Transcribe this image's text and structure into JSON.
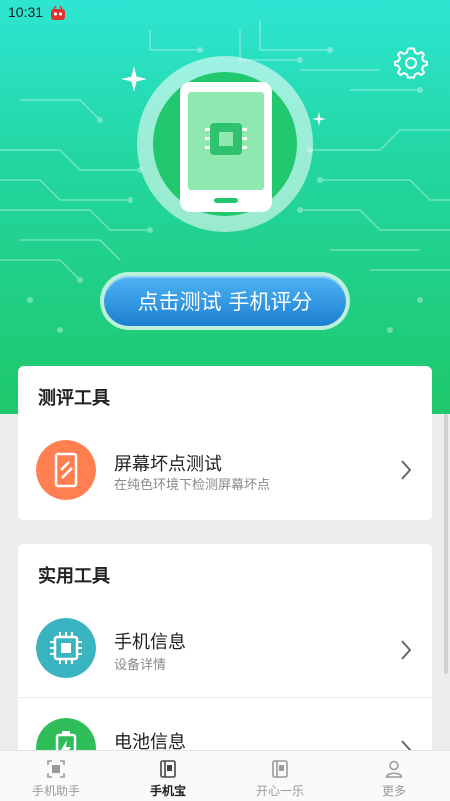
{
  "status_bar": {
    "time": "10:31"
  },
  "hero": {
    "cta_label": "点击测试 手机评分",
    "settings_icon": "gear-icon"
  },
  "evaluation_card": {
    "title": "测评工具",
    "items": [
      {
        "title": "屏幕坏点测试",
        "subtitle": "在纯色环境下检测屏幕坏点",
        "icon": "screen-icon",
        "color": "#ff7f50"
      }
    ]
  },
  "utility_card": {
    "title": "实用工具",
    "items": [
      {
        "title": "手机信息",
        "subtitle": "设备详情",
        "icon": "chip-icon",
        "color": "#3bb4c1"
      },
      {
        "title": "电池信息",
        "subtitle": "",
        "icon": "battery-icon",
        "color": "#2ebd59"
      }
    ]
  },
  "tabs": [
    {
      "label": "手机助手",
      "active": false
    },
    {
      "label": "手机宝",
      "active": true
    },
    {
      "label": "开心一乐",
      "active": false
    },
    {
      "label": "更多",
      "active": false
    }
  ],
  "colors": {
    "hero_green": "#1ec86a",
    "hero_cyan": "#2ee5d3",
    "cta_blue": "#1b7ed0"
  }
}
